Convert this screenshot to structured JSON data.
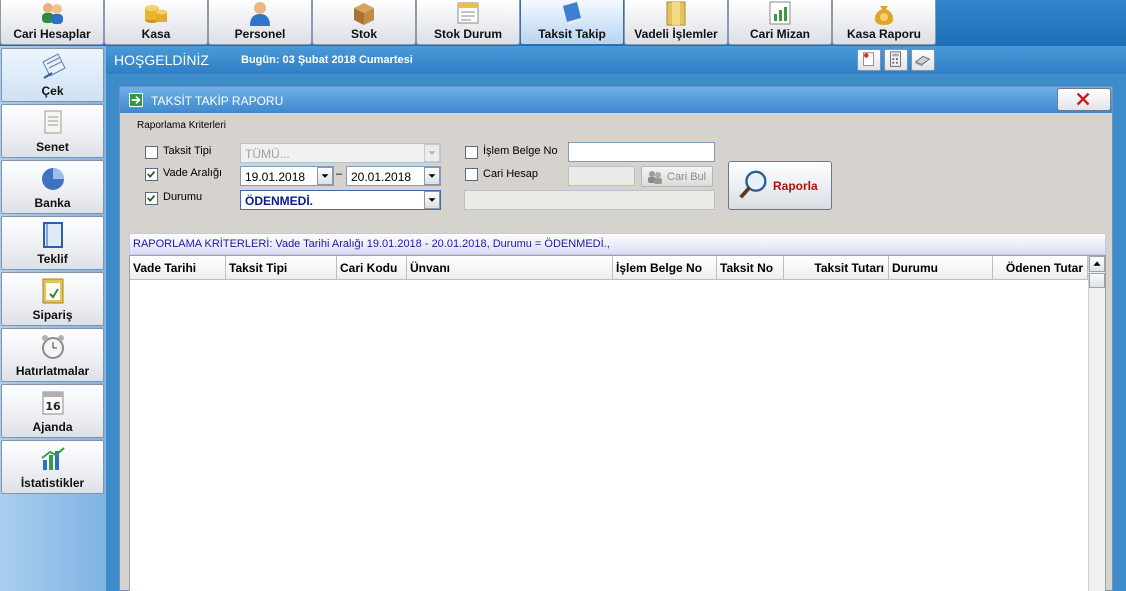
{
  "toolbar": {
    "items": [
      {
        "label": "Cari Hesaplar",
        "icon": "users-icon"
      },
      {
        "label": "Kasa",
        "icon": "coins-icon"
      },
      {
        "label": "Personel",
        "icon": "person-icon"
      },
      {
        "label": "Stok",
        "icon": "box-icon"
      },
      {
        "label": "Stok Durum",
        "icon": "document-icon"
      },
      {
        "label": "Taksit Takip",
        "icon": "book-icon"
      },
      {
        "label": "Vadeli İşlemler",
        "icon": "folder-icon"
      },
      {
        "label": "Cari Mizan",
        "icon": "chart-doc-icon"
      },
      {
        "label": "Kasa Raporu",
        "icon": "money-bag-icon"
      }
    ],
    "active": "Taksit Takip"
  },
  "sidebar": {
    "items": [
      {
        "label": "Çek",
        "icon": "check-notepad-icon"
      },
      {
        "label": "Senet",
        "icon": "paper-icon"
      },
      {
        "label": "Banka",
        "icon": "pie-chart-icon"
      },
      {
        "label": "Teklif",
        "icon": "notebook-icon"
      },
      {
        "label": "Sipariş",
        "icon": "clipboard-icon"
      },
      {
        "label": "Hatırlatmalar",
        "icon": "alarm-clock-icon"
      },
      {
        "label": "Ajanda",
        "icon": "calendar-icon"
      },
      {
        "label": "İstatistikler",
        "icon": "bar-chart-icon"
      }
    ],
    "active": "Çek"
  },
  "welcome": {
    "greeting": "HOŞGELDİNİZ",
    "today": "Bugün: 03 Şubat 2018 Cumartesi"
  },
  "dialog": {
    "title": "TAKSİT TAKİP RAPORU",
    "criteria_group": "Raporlama Kriterleri",
    "taksit_tipi": {
      "label": "Taksit Tipi",
      "checked": false,
      "value": "TÜMÜ..."
    },
    "vade_araligi": {
      "label": "Vade Aralığı",
      "checked": true,
      "from": "19.01.2018",
      "sep": "–",
      "to": "20.01.2018"
    },
    "durumu": {
      "label": "Durumu",
      "checked": true,
      "value": "ÖDENMEDİ."
    },
    "islem_belge_no": {
      "label": "İşlem Belge No",
      "checked": false,
      "value": ""
    },
    "cari_hesap": {
      "label": "Cari Hesap",
      "checked": false,
      "value": ""
    },
    "cari_bul_label": "Cari Bul",
    "raporla_label": "Raporla",
    "criteria_summary": "RAPORLAMA KRİTERLERİ:  Vade Tarihi Aralığı 19.01.2018 - 20.01.2018,  Durumu = ÖDENMEDİ.,",
    "columns": [
      "Vade Tarihi",
      "Taksit Tipi",
      "Cari Kodu",
      "Ünvanı",
      "İşlem Belge No",
      "Taksit No",
      "Taksit Tutarı",
      "Durumu",
      "Ödenen Tutar"
    ],
    "rows": []
  },
  "colors": {
    "accent": "#2e7fc4",
    "criteria_text": "#1a1aa8",
    "raporla_text": "#b01010"
  }
}
